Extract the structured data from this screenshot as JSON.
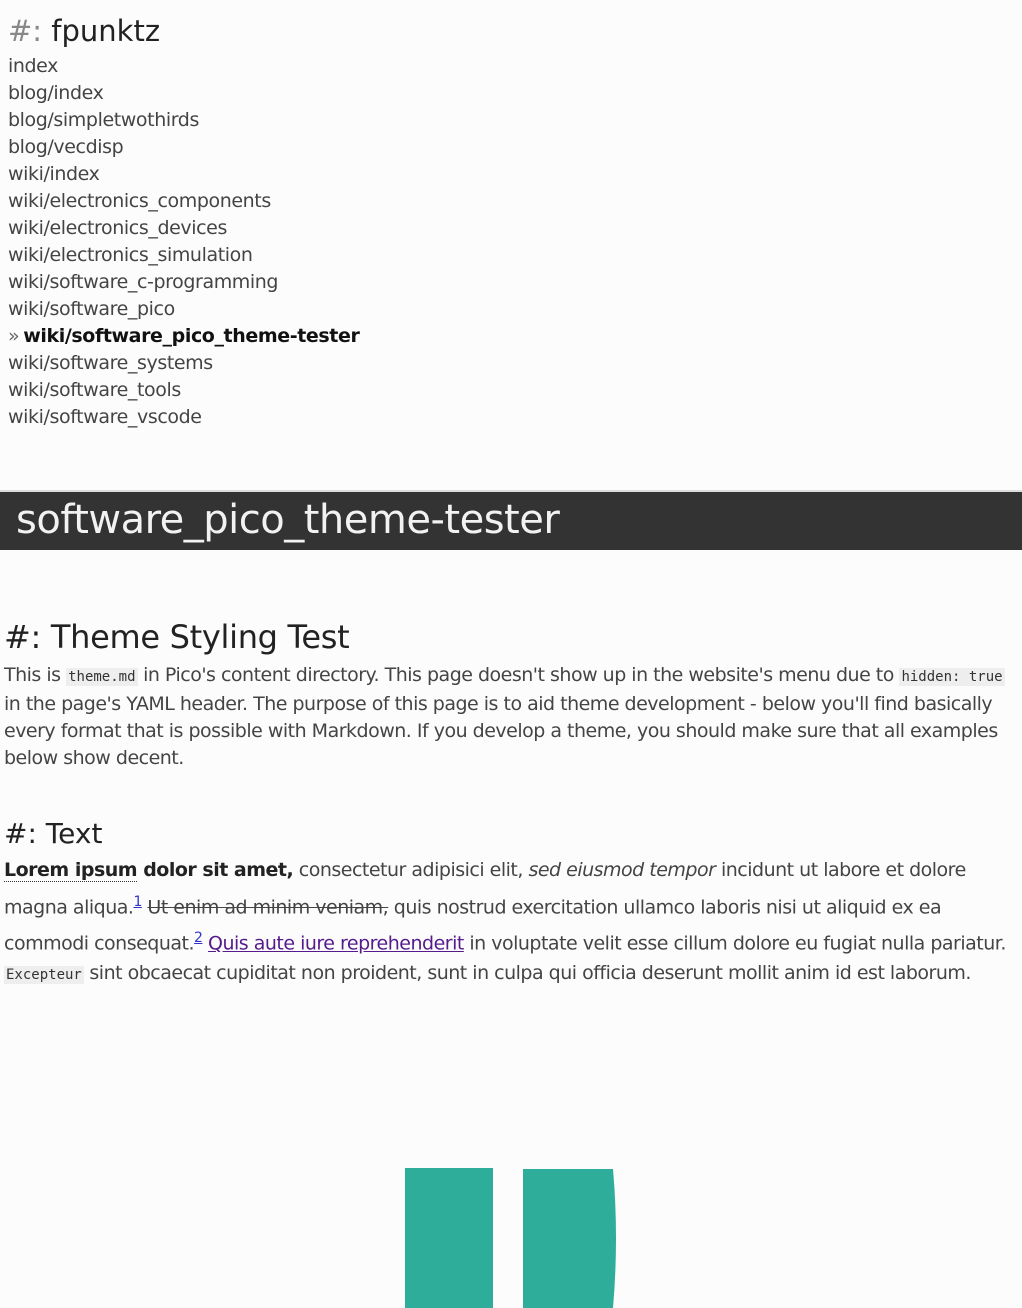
{
  "site": {
    "hash": "#:",
    "name": "fpunktz"
  },
  "nav": {
    "active_marker": "»",
    "items": [
      "index",
      "blog/index",
      "blog/simpletwothirds",
      "blog/vecdisp",
      "wiki/index",
      "wiki/electronics_components",
      "wiki/electronics_devices",
      "wiki/electronics_simulation",
      "wiki/software_c-programming",
      "wiki/software_pico",
      "wiki/software_pico_theme-tester",
      "wiki/software_systems",
      "wiki/software_tools",
      "wiki/software_vscode"
    ]
  },
  "page": {
    "title": "software_pico_theme-tester"
  },
  "content": {
    "heading1": "#: Theme Styling Test",
    "intro": {
      "t1": "This is ",
      "code1": "theme.md",
      "t2": " in Pico's content directory. This page doesn't show up in the website's menu due to ",
      "code2": "hidden: true",
      "t3": " in the page's YAML header. The purpose of this page is to aid theme development - below you'll find basically every format that is possible with Markdown. If you develop a theme, you should make sure that all examples below show decent."
    },
    "heading2": "#: Text",
    "text": {
      "abbr": "Lorem ipsum",
      "bold_rest": " dolor sit amet,",
      "t1": " consectetur adipisici elit, ",
      "italic": "sed eiusmod tempor",
      "t2": " incidunt ut labore et dolore magna aliqua.",
      "fn1": "1",
      "t3": " ",
      "strike": "Ut enim ad minim veniam,",
      "t4": " quis nostrud exercitation ullamco laboris nisi ut aliquid ex ea commodi consequat.",
      "fn2": "2",
      "t5": " ",
      "link": "Quis aute iure reprehenderit",
      "t6": " in voluptate velit esse cillum dolore eu fugiat nulla pariatur. ",
      "code": "Excepteur",
      "t7": " sint obcaecat cupiditat non proident, sunt in culpa qui officia deserunt mollit anim id est laborum."
    }
  },
  "colors": {
    "banner_bg": "#333333",
    "logo": "#2eae9a",
    "link_visited": "#551a8b"
  }
}
